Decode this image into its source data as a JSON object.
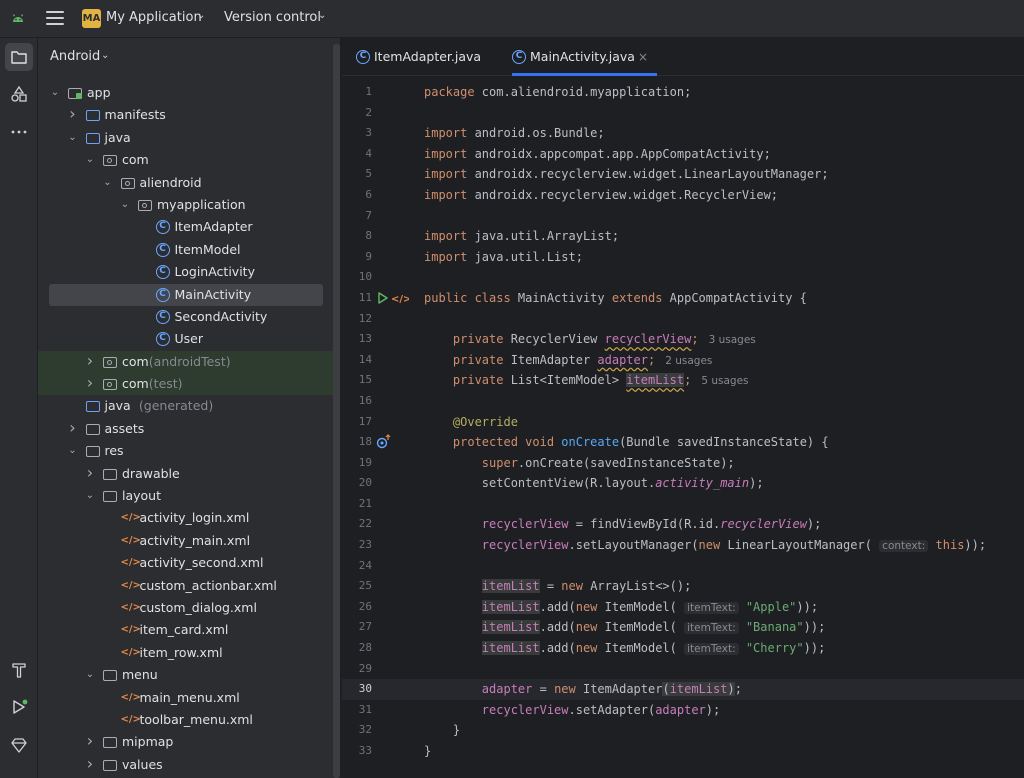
{
  "titlebar": {
    "project_badge": "MA",
    "project_name": "My Application",
    "vcs": "Version control"
  },
  "project_panel": {
    "view": "Android",
    "tree": [
      {
        "depth": 0,
        "arrow": "v",
        "icon": "app",
        "label": "app"
      },
      {
        "depth": 1,
        "arrow": ">",
        "icon": "folder-blue",
        "label": "manifests"
      },
      {
        "depth": 1,
        "arrow": "v",
        "icon": "folder-blue",
        "label": "java"
      },
      {
        "depth": 2,
        "arrow": "v",
        "icon": "package",
        "label": "com"
      },
      {
        "depth": 3,
        "arrow": "v",
        "icon": "package",
        "label": "aliendroid"
      },
      {
        "depth": 4,
        "arrow": "v",
        "icon": "package",
        "label": "myapplication"
      },
      {
        "depth": 5,
        "arrow": "",
        "icon": "class",
        "label": "ItemAdapter"
      },
      {
        "depth": 5,
        "arrow": "",
        "icon": "class",
        "label": "ItemModel"
      },
      {
        "depth": 5,
        "arrow": "",
        "icon": "class",
        "label": "LoginActivity"
      },
      {
        "depth": 5,
        "arrow": "",
        "icon": "class",
        "label": "MainActivity",
        "selected": true
      },
      {
        "depth": 5,
        "arrow": "",
        "icon": "class",
        "label": "SecondActivity"
      },
      {
        "depth": 5,
        "arrow": "",
        "icon": "class",
        "label": "User"
      },
      {
        "depth": 2,
        "arrow": ">",
        "icon": "package",
        "label": "com",
        "suffix": "(androidTest)",
        "highlight": true
      },
      {
        "depth": 2,
        "arrow": ">",
        "icon": "package",
        "label": "com",
        "suffix": "(test)",
        "highlight": true
      },
      {
        "depth": 1,
        "arrow": "",
        "icon": "folder-blue",
        "label": "java",
        "suffix": "(generated)"
      },
      {
        "depth": 1,
        "arrow": ">",
        "icon": "folder",
        "label": "assets"
      },
      {
        "depth": 1,
        "arrow": "v",
        "icon": "folder",
        "label": "res"
      },
      {
        "depth": 2,
        "arrow": ">",
        "icon": "folder",
        "label": "drawable"
      },
      {
        "depth": 2,
        "arrow": "v",
        "icon": "folder",
        "label": "layout"
      },
      {
        "depth": 3,
        "arrow": "",
        "icon": "xml",
        "label": "activity_login.xml"
      },
      {
        "depth": 3,
        "arrow": "",
        "icon": "xml",
        "label": "activity_main.xml"
      },
      {
        "depth": 3,
        "arrow": "",
        "icon": "xml",
        "label": "activity_second.xml"
      },
      {
        "depth": 3,
        "arrow": "",
        "icon": "xml",
        "label": "custom_actionbar.xml"
      },
      {
        "depth": 3,
        "arrow": "",
        "icon": "xml",
        "label": "custom_dialog.xml"
      },
      {
        "depth": 3,
        "arrow": "",
        "icon": "xml",
        "label": "item_card.xml"
      },
      {
        "depth": 3,
        "arrow": "",
        "icon": "xml",
        "label": "item_row.xml"
      },
      {
        "depth": 2,
        "arrow": "v",
        "icon": "folder",
        "label": "menu"
      },
      {
        "depth": 3,
        "arrow": "",
        "icon": "xml",
        "label": "main_menu.xml"
      },
      {
        "depth": 3,
        "arrow": "",
        "icon": "xml",
        "label": "toolbar_menu.xml"
      },
      {
        "depth": 2,
        "arrow": ">",
        "icon": "folder",
        "label": "mipmap"
      },
      {
        "depth": 2,
        "arrow": ">",
        "icon": "folder",
        "label": "values"
      }
    ]
  },
  "editor": {
    "tabs": [
      {
        "label": "ItemAdapter.java",
        "active": false
      },
      {
        "label": "MainActivity.java",
        "active": true,
        "close": "×"
      }
    ],
    "current_line": 30,
    "lines": [
      {
        "n": "1",
        "segs": [
          [
            "kw",
            "package "
          ],
          [
            "",
            "com.aliendroid.myapplication;"
          ]
        ]
      },
      {
        "n": "2",
        "segs": []
      },
      {
        "n": "3",
        "segs": [
          [
            "kw",
            "import "
          ],
          [
            "",
            "android.os.Bundle;"
          ]
        ]
      },
      {
        "n": "4",
        "segs": [
          [
            "kw",
            "import "
          ],
          [
            "",
            "androidx.appcompat.app.AppCompatActivity;"
          ]
        ]
      },
      {
        "n": "5",
        "segs": [
          [
            "kw",
            "import "
          ],
          [
            "",
            "androidx.recyclerview.widget.LinearLayoutManager;"
          ]
        ]
      },
      {
        "n": "6",
        "segs": [
          [
            "kw",
            "import "
          ],
          [
            "",
            "androidx.recyclerview.widget.RecyclerView;"
          ]
        ]
      },
      {
        "n": "7",
        "segs": []
      },
      {
        "n": "8",
        "segs": [
          [
            "kw",
            "import "
          ],
          [
            "",
            "java.util.ArrayList;"
          ]
        ]
      },
      {
        "n": "9",
        "segs": [
          [
            "kw",
            "import "
          ],
          [
            "",
            "java.util.List;"
          ]
        ]
      },
      {
        "n": "10",
        "segs": []
      },
      {
        "n": "11",
        "gutter": "run",
        "segs": [
          [
            "kw",
            "public class "
          ],
          [
            "",
            "MainActivity "
          ],
          [
            "kw",
            "extends "
          ],
          [
            "",
            "AppCompatActivity {"
          ]
        ]
      },
      {
        "n": "12",
        "segs": []
      },
      {
        "n": "13",
        "segs": [
          [
            "",
            "    "
          ],
          [
            "kw",
            "private "
          ],
          [
            "",
            "RecyclerView "
          ],
          [
            "fld sqg",
            "recyclerView"
          ],
          [
            "kw",
            ";"
          ],
          [
            "hint",
            "   3 usages"
          ]
        ]
      },
      {
        "n": "14",
        "segs": [
          [
            "",
            "    "
          ],
          [
            "kw",
            "private "
          ],
          [
            "",
            "ItemAdapter "
          ],
          [
            "fld sqg",
            "adapter"
          ],
          [
            "kw",
            ";"
          ],
          [
            "hint",
            "   2 usages"
          ]
        ]
      },
      {
        "n": "15",
        "segs": [
          [
            "",
            "    "
          ],
          [
            "kw",
            "private "
          ],
          [
            "",
            "List<ItemModel> "
          ],
          [
            "fld sqg hl2",
            "itemList"
          ],
          [
            "kw",
            ";"
          ],
          [
            "hint",
            "   5 usages"
          ]
        ]
      },
      {
        "n": "16",
        "segs": []
      },
      {
        "n": "17",
        "segs": [
          [
            "",
            "    "
          ],
          [
            "ann",
            "@Override"
          ]
        ]
      },
      {
        "n": "18",
        "gutter": "override",
        "segs": [
          [
            "",
            "    "
          ],
          [
            "kw",
            "protected void "
          ],
          [
            "mth",
            "onCreate"
          ],
          [
            "",
            "(Bundle savedInstanceState) {"
          ]
        ]
      },
      {
        "n": "19",
        "segs": [
          [
            "",
            "        "
          ],
          [
            "kw",
            "super"
          ],
          [
            "",
            ".onCreate(savedInstanceState);"
          ]
        ]
      },
      {
        "n": "20",
        "segs": [
          [
            "",
            "        setContentView(R.layout."
          ],
          [
            "fld it",
            "activity_main"
          ],
          [
            "",
            ");"
          ]
        ]
      },
      {
        "n": "21",
        "segs": []
      },
      {
        "n": "22",
        "segs": [
          [
            "",
            "        "
          ],
          [
            "fld",
            "recyclerView"
          ],
          [
            "",
            " = findViewById(R.id."
          ],
          [
            "fld it",
            "recyclerView"
          ],
          [
            "",
            ");"
          ]
        ]
      },
      {
        "n": "23",
        "segs": [
          [
            "",
            "        "
          ],
          [
            "fld",
            "recyclerView"
          ],
          [
            "",
            ".setLayoutManager("
          ],
          [
            "kw",
            "new "
          ],
          [
            "",
            "LinearLayoutManager( "
          ],
          [
            "hint-box",
            "context:"
          ],
          [
            "kw",
            " this"
          ],
          [
            "",
            "));"
          ]
        ]
      },
      {
        "n": "24",
        "segs": []
      },
      {
        "n": "25",
        "segs": [
          [
            "",
            "        "
          ],
          [
            "fld hl",
            "itemList"
          ],
          [
            "",
            " = "
          ],
          [
            "kw",
            "new "
          ],
          [
            "",
            "ArrayList<>();"
          ]
        ]
      },
      {
        "n": "26",
        "segs": [
          [
            "",
            "        "
          ],
          [
            "fld hl",
            "itemList"
          ],
          [
            "",
            ".add("
          ],
          [
            "kw",
            "new "
          ],
          [
            "",
            "ItemModel( "
          ],
          [
            "hint-box",
            "itemText:"
          ],
          [
            "str",
            " \"Apple\""
          ],
          [
            "",
            "));"
          ]
        ]
      },
      {
        "n": "27",
        "segs": [
          [
            "",
            "        "
          ],
          [
            "fld hl",
            "itemList"
          ],
          [
            "",
            ".add("
          ],
          [
            "kw",
            "new "
          ],
          [
            "",
            "ItemModel( "
          ],
          [
            "hint-box",
            "itemText:"
          ],
          [
            "str",
            " \"Banana\""
          ],
          [
            "",
            "));"
          ]
        ]
      },
      {
        "n": "28",
        "segs": [
          [
            "",
            "        "
          ],
          [
            "fld hl",
            "itemList"
          ],
          [
            "",
            ".add("
          ],
          [
            "kw",
            "new "
          ],
          [
            "",
            "ItemModel( "
          ],
          [
            "hint-box",
            "itemText:"
          ],
          [
            "str",
            " \"Cherry\""
          ],
          [
            "",
            "));"
          ]
        ]
      },
      {
        "n": "29",
        "segs": []
      },
      {
        "n": "30",
        "segs": [
          [
            "",
            "        "
          ],
          [
            "fld",
            "adapter"
          ],
          [
            "",
            " = "
          ],
          [
            "kw",
            "new "
          ],
          [
            "",
            "ItemAdapter"
          ],
          [
            "hl2",
            "("
          ],
          [
            "fld hl",
            "itemList"
          ],
          [
            "hl2",
            ")"
          ],
          [
            "",
            ";"
          ]
        ]
      },
      {
        "n": "31",
        "segs": [
          [
            "",
            "        "
          ],
          [
            "fld",
            "recyclerView"
          ],
          [
            "",
            ".setAdapter("
          ],
          [
            "fld",
            "adapter"
          ],
          [
            "",
            ");"
          ]
        ]
      },
      {
        "n": "32",
        "segs": [
          [
            "",
            "    }"
          ]
        ]
      },
      {
        "n": "33",
        "segs": [
          [
            "",
            "}"
          ]
        ]
      }
    ]
  },
  "colors": {
    "accent": "#3574f0",
    "keyword": "#cf8e6d",
    "field": "#c77dbb",
    "string": "#6aab73",
    "annotation": "#b3ae60",
    "method": "#56a8f5"
  },
  "toolstrip": [
    "project-icon",
    "resource-manager-icon",
    "more-icon",
    "build-icon",
    "run-icon",
    "gem-icon"
  ]
}
